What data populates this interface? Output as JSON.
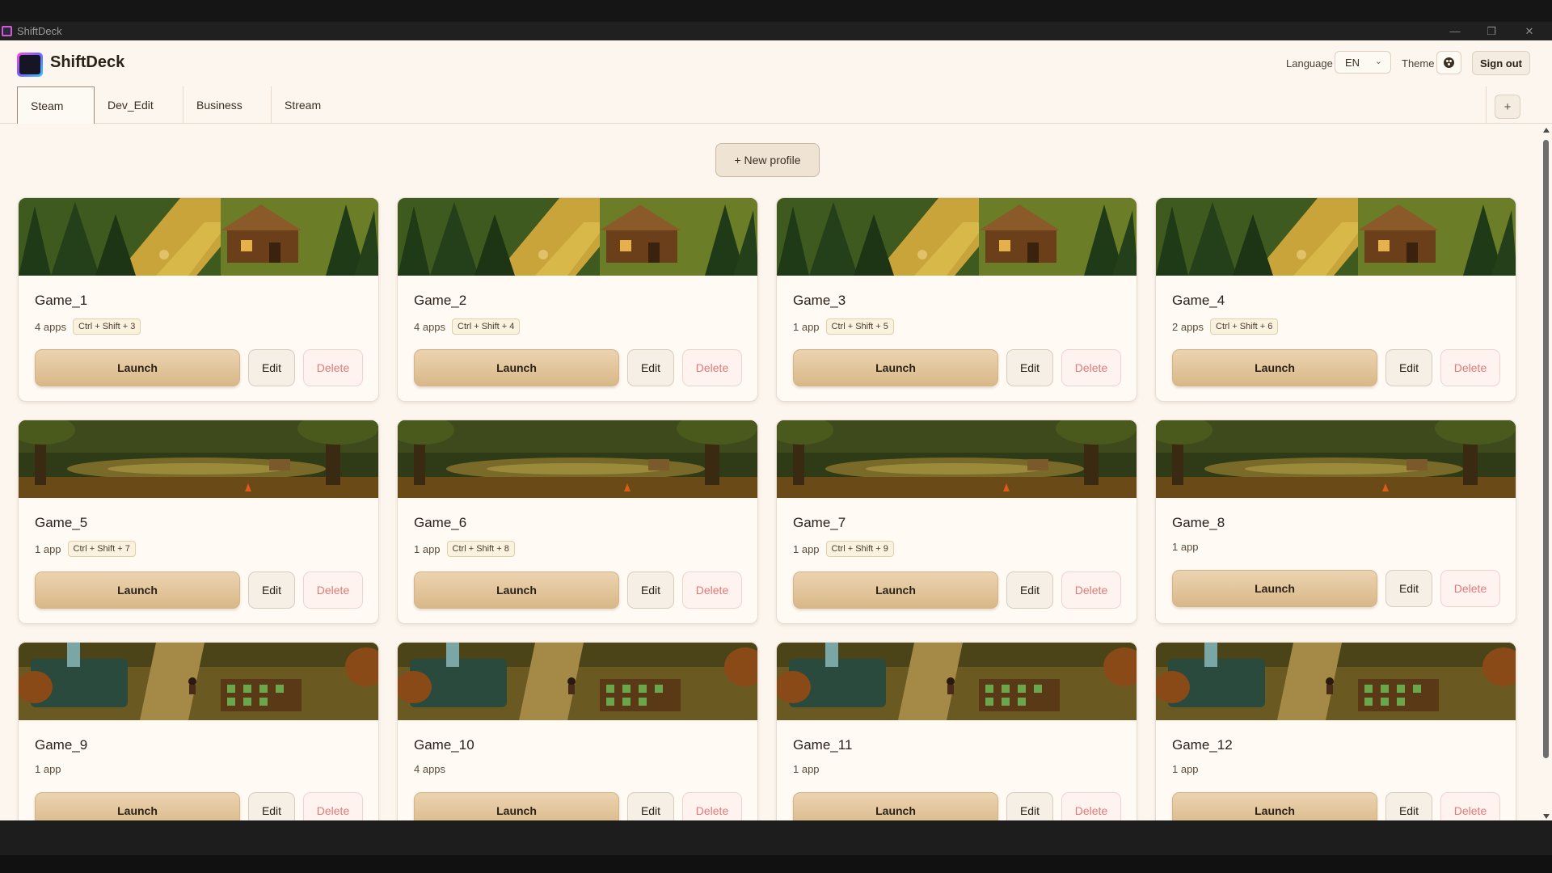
{
  "window": {
    "title": "ShiftDeck",
    "minimize": "—",
    "maximize": "❐",
    "close": "✕"
  },
  "header": {
    "brand": "ShiftDeck",
    "language_label": "Language",
    "language_value": "EN",
    "theme_label": "Theme",
    "sign_out": "Sign out"
  },
  "tabs": [
    {
      "label": "Steam",
      "active": true
    },
    {
      "label": "Dev_Edit",
      "active": false
    },
    {
      "label": "Business",
      "active": false
    },
    {
      "label": "Stream",
      "active": false
    }
  ],
  "add_tab_label": "+",
  "new_profile_label": "+ New profile",
  "card_labels": {
    "launch": "Launch",
    "edit": "Edit",
    "delete": "Delete"
  },
  "profiles": [
    {
      "name": "Game_1",
      "apps": "4 apps",
      "hotkey": "Ctrl + Shift + 3",
      "banner": "cabin"
    },
    {
      "name": "Game_2",
      "apps": "4 apps",
      "hotkey": "Ctrl + Shift + 4",
      "banner": "cabin"
    },
    {
      "name": "Game_3",
      "apps": "1 app",
      "hotkey": "Ctrl + Shift + 5",
      "banner": "cabin"
    },
    {
      "name": "Game_4",
      "apps": "2 apps",
      "hotkey": "Ctrl + Shift + 6",
      "banner": "cabin"
    },
    {
      "name": "Game_5",
      "apps": "1 app",
      "hotkey": "Ctrl + Shift + 7",
      "banner": "grove"
    },
    {
      "name": "Game_6",
      "apps": "1 app",
      "hotkey": "Ctrl + Shift + 8",
      "banner": "grove"
    },
    {
      "name": "Game_7",
      "apps": "1 app",
      "hotkey": "Ctrl + Shift + 9",
      "banner": "grove"
    },
    {
      "name": "Game_8",
      "apps": "1 app",
      "hotkey": "",
      "banner": "grove"
    },
    {
      "name": "Game_9",
      "apps": "1 app",
      "hotkey": "",
      "banner": "farm"
    },
    {
      "name": "Game_10",
      "apps": "4 apps",
      "hotkey": "",
      "banner": "farm"
    },
    {
      "name": "Game_11",
      "apps": "1 app",
      "hotkey": "",
      "banner": "farm"
    },
    {
      "name": "Game_12",
      "apps": "1 app",
      "hotkey": "",
      "banner": "farm"
    }
  ],
  "colors": {
    "accent": "#d8b888",
    "background": "#fdf6ee",
    "danger": "#e07a78"
  }
}
